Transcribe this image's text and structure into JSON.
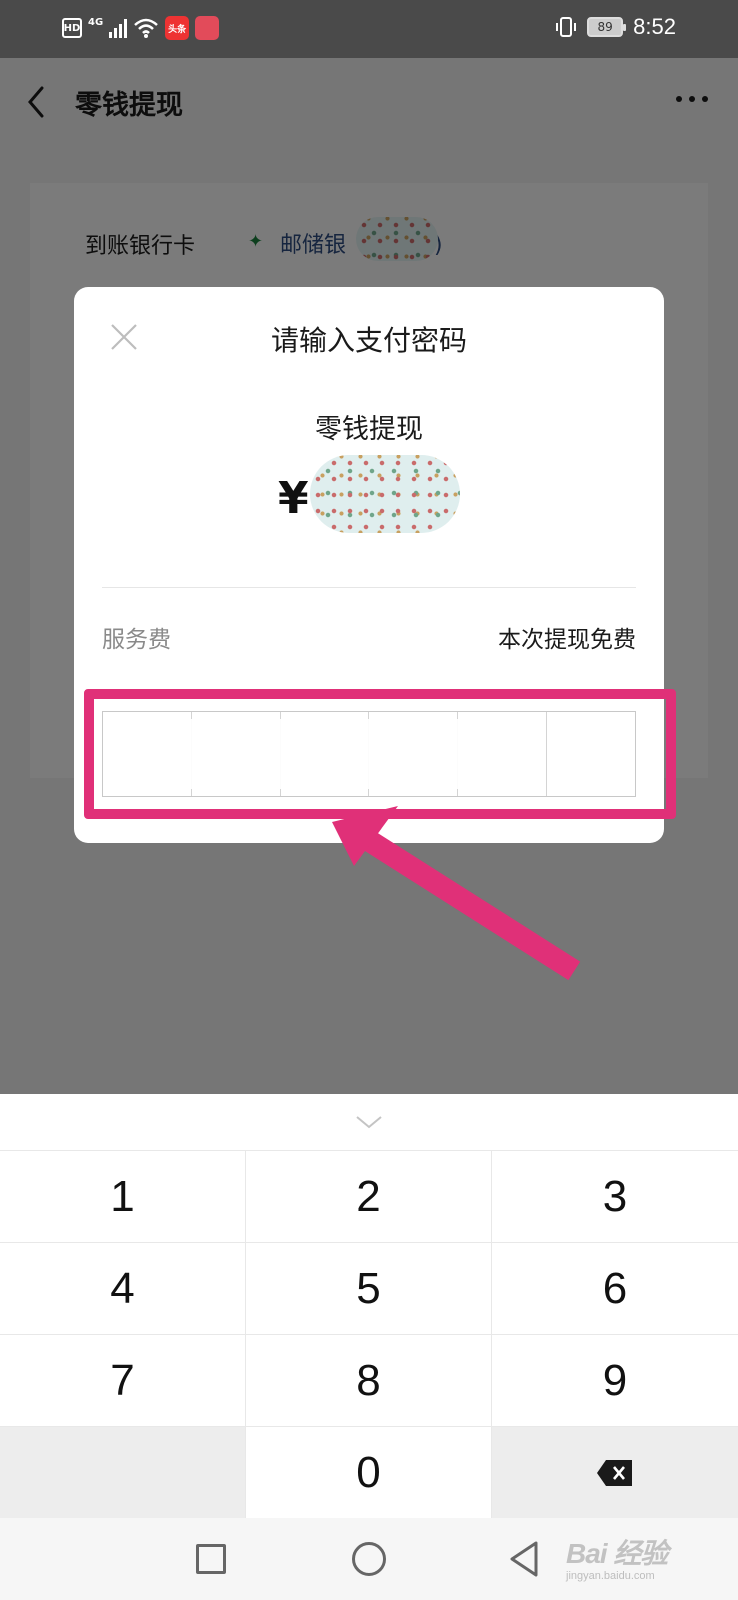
{
  "status_bar": {
    "hd": "HD",
    "network": "4G",
    "app_badge": "头条",
    "battery": "89",
    "time": "8:52"
  },
  "header": {
    "title": "零钱提现",
    "back_icon": "chevron-left-icon",
    "more_icon": "more-horizontal-icon"
  },
  "card": {
    "label": "到账银行卡",
    "bank_name": "邮储银",
    "bank_suffix": ")"
  },
  "dialog": {
    "title": "请输入支付密码",
    "subtitle": "零钱提现",
    "currency": "¥",
    "fee_label": "服务费",
    "fee_value": "本次提现免费",
    "password_cells": 6
  },
  "keyboard": {
    "keys": [
      "1",
      "2",
      "3",
      "4",
      "5",
      "6",
      "7",
      "8",
      "9",
      "",
      "0",
      "⌫"
    ],
    "collapse_icon": "chevron-down-icon",
    "delete_icon": "backspace-icon"
  },
  "annotation": {
    "color": "#e03078"
  },
  "watermark": {
    "main": "Bai 经验",
    "sub": "jingyan.baidu.com"
  }
}
